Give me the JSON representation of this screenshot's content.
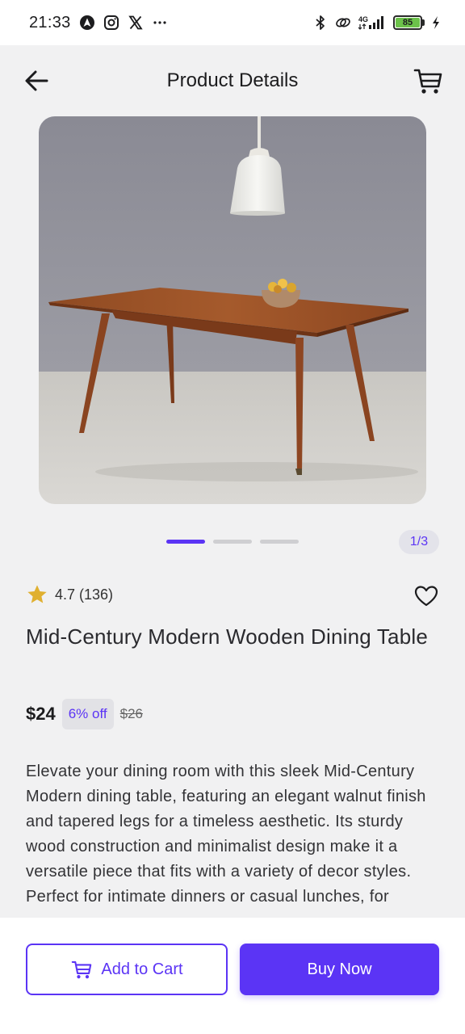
{
  "status_bar": {
    "time": "21:33",
    "left_icons": [
      "navigation-a-icon",
      "instagram-icon",
      "x-icon",
      "more-dots-icon"
    ],
    "right_icons": [
      "bluetooth-icon",
      "link-icon",
      "signal-4g-icon"
    ],
    "network": "4G",
    "battery": "85"
  },
  "header": {
    "title": "Product Details",
    "back_icon": "arrow-left-icon",
    "cart_icon": "cart-icon"
  },
  "carousel": {
    "indicator": "1/3",
    "total": 3,
    "active": 1
  },
  "product": {
    "rating": "4.7 (136)",
    "title": "Mid-Century Modern Wooden Dining Table",
    "price": "$24",
    "discount": "6% off",
    "old_price": "$26",
    "description": "Elevate your dining room with this sleek Mid-Century Modern dining table, featuring an elegant walnut finish and tapered legs for a timeless aesthetic. Its sturdy wood construction and minimalist design make it a versatile piece that fits with a variety of decor styles. Perfect for intimate dinners or casual lunches, for"
  },
  "actions": {
    "add_to_cart": "Add to Cart",
    "buy_now": "Buy Now"
  },
  "colors": {
    "accent": "#5b34f5",
    "star": "#e0b030",
    "background": "#f1f1f2"
  }
}
